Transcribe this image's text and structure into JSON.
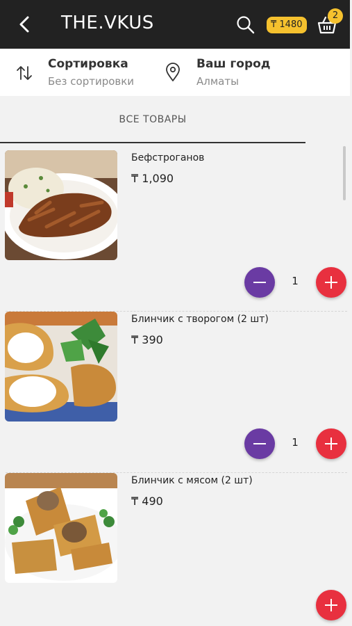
{
  "header": {
    "brand": "THE.VKUS",
    "balance": "₸ 1480",
    "cart_count": "2",
    "accent": "#f5c12e",
    "background": "#222222",
    "icons": [
      "back-arrow-icon",
      "search-icon",
      "basket-icon"
    ]
  },
  "filters": {
    "sort_title": "Сортировка",
    "sort_value": "Без сортировки",
    "city_title": "Ваш город",
    "city_value": "Алматы"
  },
  "tab": {
    "label": "ВСЕ ТОВАРЫ"
  },
  "colors": {
    "minus": "#6a3ba3",
    "plus": "#e8303f"
  },
  "products": [
    {
      "name": "Бефстроганов",
      "price": "₸ 1,090",
      "qty": "1"
    },
    {
      "name": "Блинчик с творогом (2 шт)",
      "price": "₸ 390",
      "qty": "1"
    },
    {
      "name": "Блинчик с мясом (2 шт)",
      "price": "₸ 490",
      "qty": ""
    }
  ]
}
